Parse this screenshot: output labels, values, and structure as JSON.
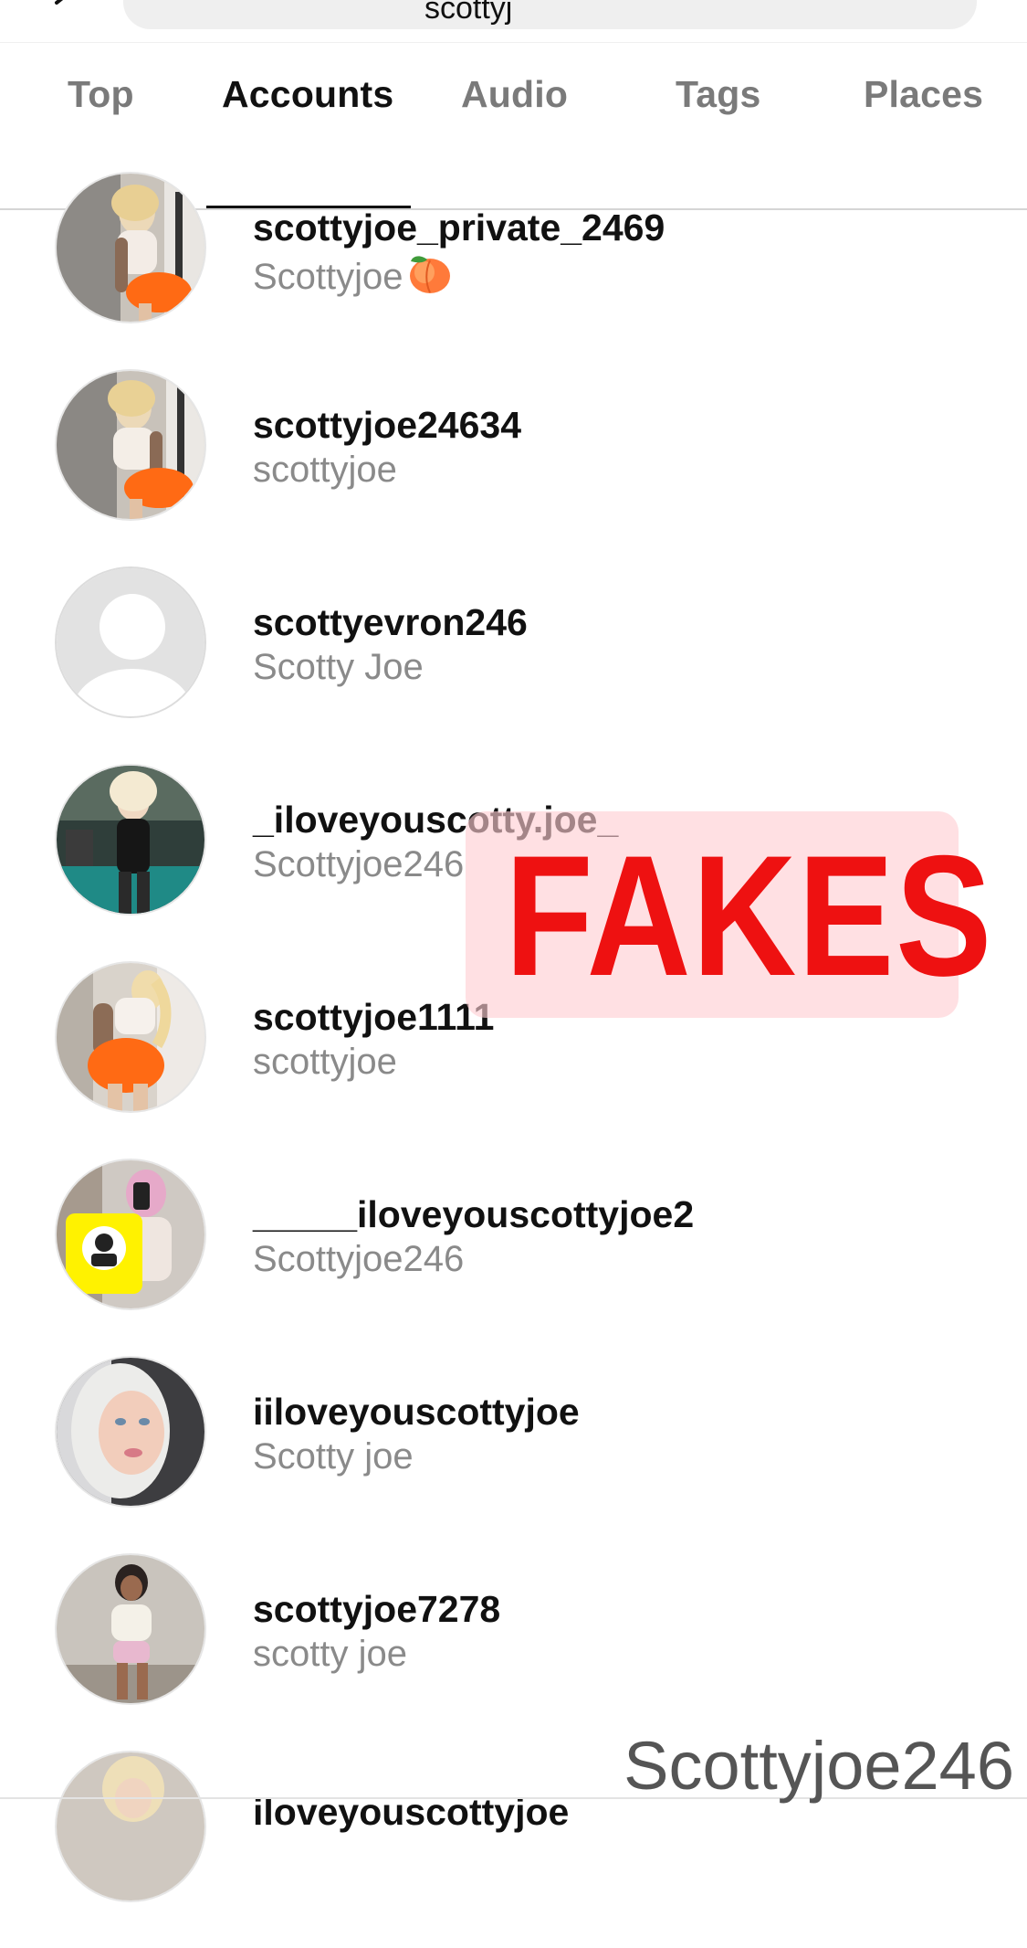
{
  "search": {
    "query": "scottyj"
  },
  "tabs": [
    {
      "label": "Top",
      "active": false
    },
    {
      "label": "Accounts",
      "active": true
    },
    {
      "label": "Audio",
      "active": false
    },
    {
      "label": "Tags",
      "active": false
    },
    {
      "label": "Places",
      "active": false
    }
  ],
  "accounts": [
    {
      "username": "scottyjoe_private_2469",
      "name": "Scottyjoe",
      "name_emoji": "peach-emoji"
    },
    {
      "username": "scottyjoe24634",
      "name": "scottyjoe"
    },
    {
      "username": "scottyevron246",
      "name": "Scotty Joe",
      "avatar": "default-avatar"
    },
    {
      "username": "_iloveyouscotty.joe_",
      "name": "Scottyjoe246"
    },
    {
      "username": "scottyjoe1111",
      "name": "scottyjoe"
    },
    {
      "username": "_____iloveyouscottyjoe2",
      "name": "Scottyjoe246"
    },
    {
      "username": "iiloveyouscottyjoe",
      "name": "Scotty joe"
    },
    {
      "username": "scottyjoe7278",
      "name": "scotty joe"
    },
    {
      "username": "iloveyouscottyjoe",
      "name": ""
    }
  ],
  "overlay": {
    "stamp_text": "FAKES",
    "stamp_color": "#ee1111",
    "watermark": "Scottyjoe246"
  },
  "colors": {
    "primary_text": "#111111",
    "secondary_text": "#8a8a8a",
    "tab_inactive": "#7a7a7a"
  }
}
